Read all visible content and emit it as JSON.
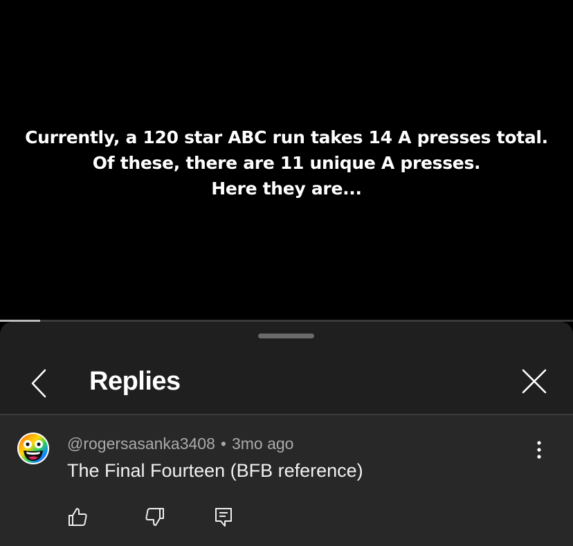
{
  "video": {
    "caption_lines": [
      "Currently, a 120 star ABC run takes 14 A presses total.",
      "Of these, there are 11 unique A presses.",
      "Here they are..."
    ],
    "progress_fraction": 0.07
  },
  "replies_panel": {
    "title": "Replies",
    "back_icon": "chevron-left-icon",
    "close_icon": "close-icon"
  },
  "comment": {
    "author": "@rogersasanka3408",
    "separator": "•",
    "time": "3mo ago",
    "text": "The Final Fourteen (BFB reference)",
    "avatar_icon": "rainbow-smiley-avatar",
    "actions": [
      "thumbs-up-icon",
      "thumbs-down-icon",
      "reply-icon"
    ],
    "more_icon": "more-vertical-icon"
  },
  "colors": {
    "background": "#000000",
    "sheet": "#1f1f1f",
    "comment_bg": "#282828",
    "meta_text": "#aaaaaa",
    "body_text": "#f1f1f1"
  }
}
